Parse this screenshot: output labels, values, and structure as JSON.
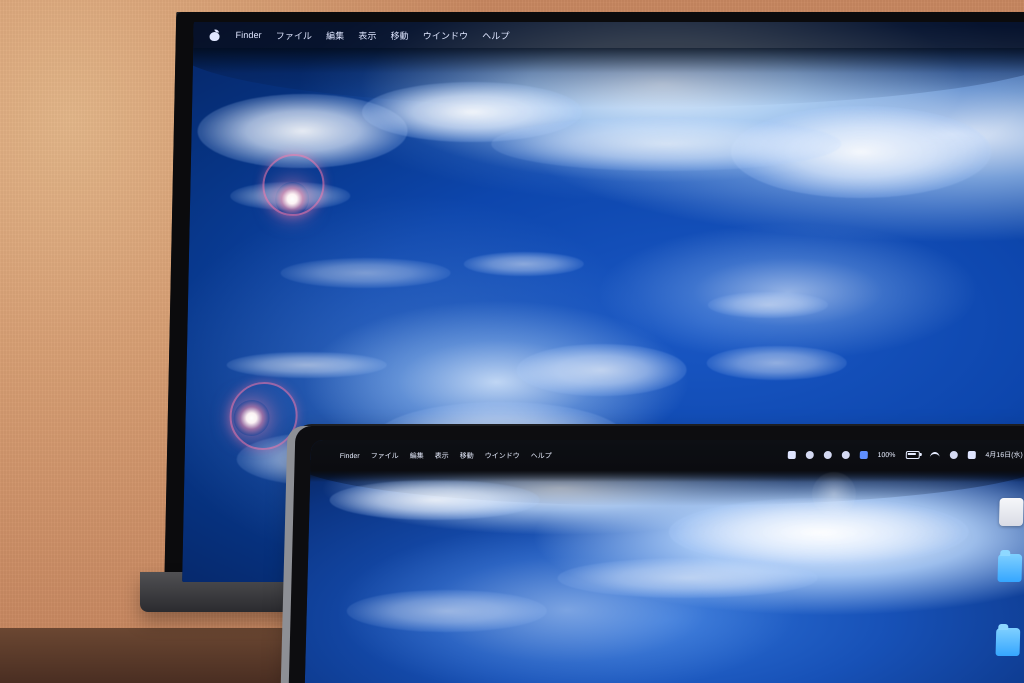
{
  "external_display": {
    "menu_bar": {
      "items": [
        "Finder",
        "ファイル",
        "編集",
        "表示",
        "移動",
        "ウインドウ",
        "ヘルプ"
      ]
    }
  },
  "laptop_display": {
    "menu_bar": {
      "items": [
        "Finder",
        "ファイル",
        "編集",
        "表示",
        "移動",
        "ウインドウ",
        "ヘルプ"
      ],
      "status_text": [
        "100%",
        "4月16日(水)"
      ]
    }
  },
  "colors": {
    "wall": "#d79f74",
    "ocean_deep": "#073586",
    "ocean_mid": "#1a58c5",
    "cloud": "#e8f2ff",
    "flare": "#ff8fb5"
  }
}
